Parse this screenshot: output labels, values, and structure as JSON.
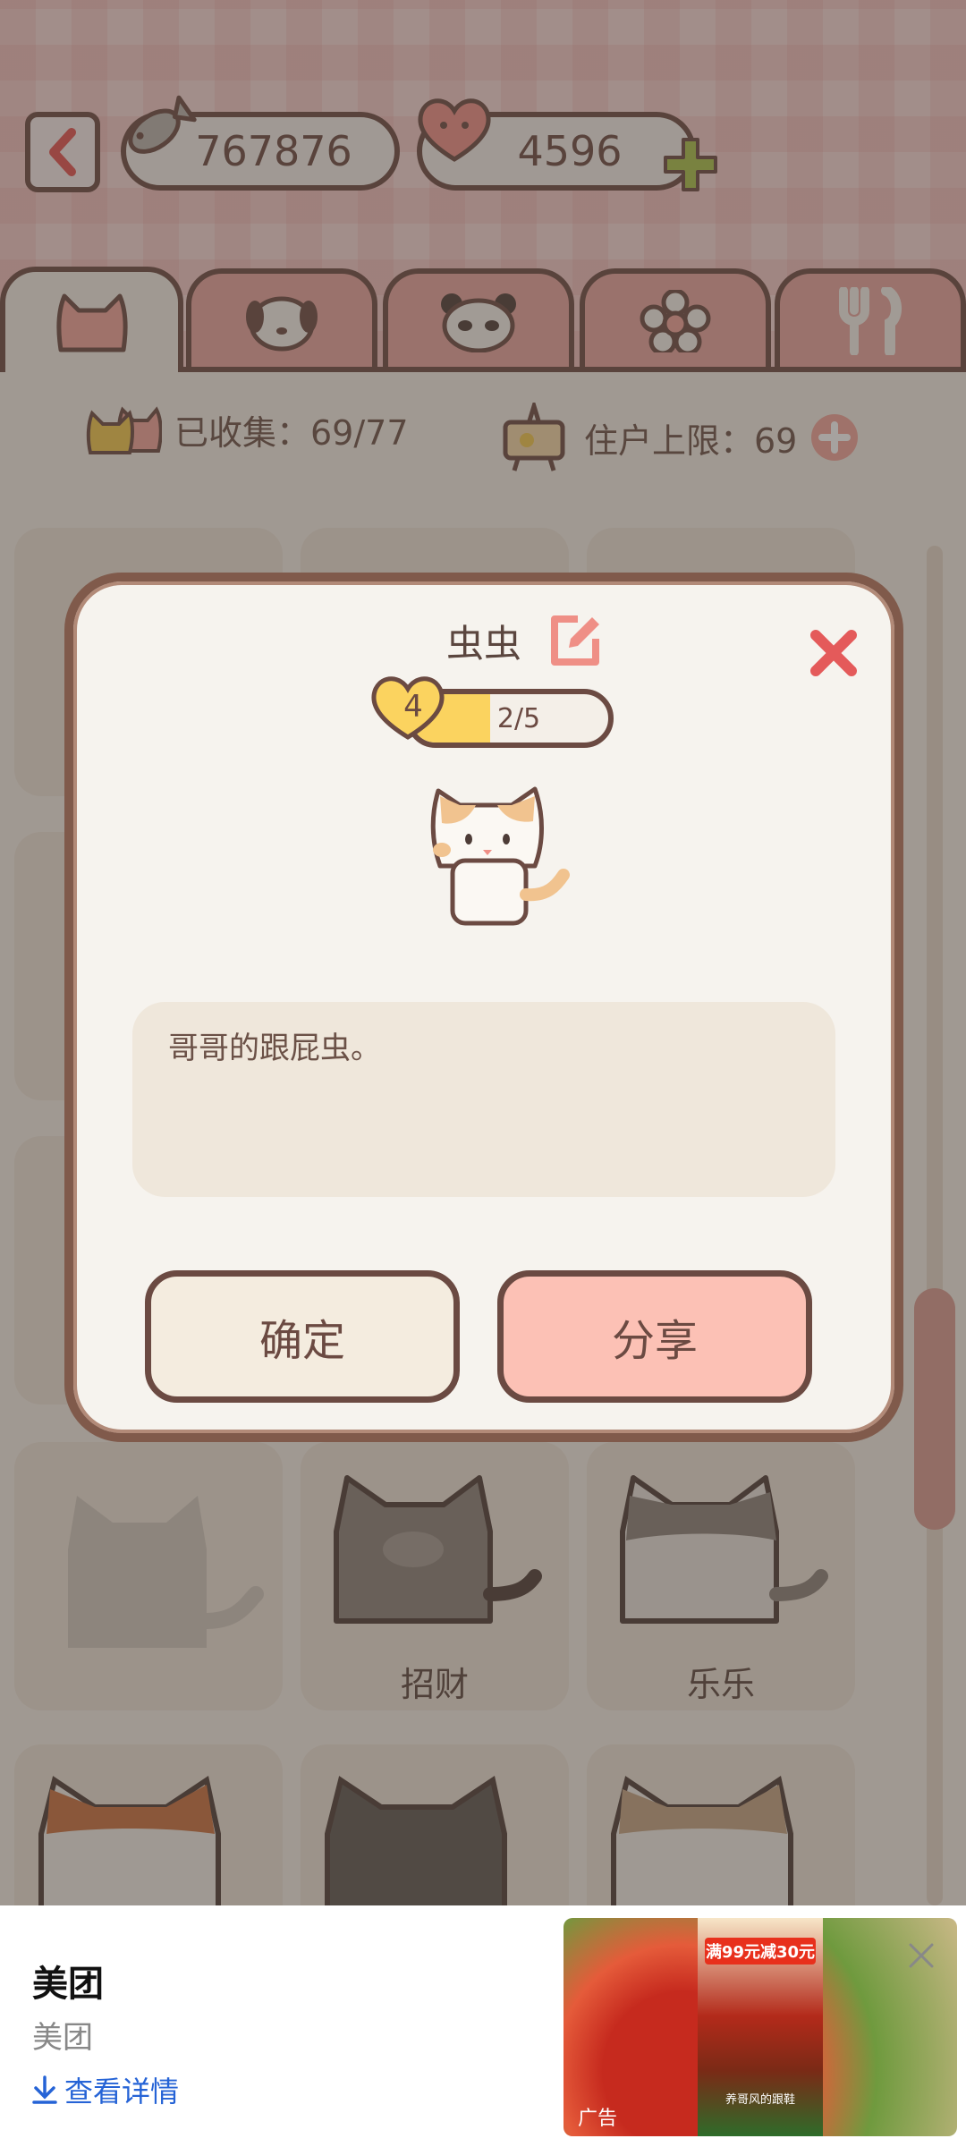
{
  "header": {
    "fish_count": "767876",
    "heart_count": "4596"
  },
  "tabs": [
    {
      "icon": "cat-tab-icon",
      "active": true
    },
    {
      "icon": "dog-tab-icon",
      "active": false
    },
    {
      "icon": "panda-tab-icon",
      "active": false
    },
    {
      "icon": "flower-tab-icon",
      "active": false
    },
    {
      "icon": "fork-tab-icon",
      "active": false
    }
  ],
  "stats": {
    "collected_label": "已收集：69/77",
    "capacity_label": "住户上限：69"
  },
  "grid": {
    "names": [
      "招财",
      "乐乐"
    ]
  },
  "modal": {
    "title": "虫虫",
    "level": "4",
    "progress_text": "2/5",
    "progress_fraction": 0.4,
    "description": "哥哥的跟屁虫。",
    "confirm_label": "确定",
    "share_label": "分享"
  },
  "ad": {
    "title": "美团",
    "subtitle": "美团",
    "link_label": "查看详情",
    "promo_text": "满99元减30元",
    "poster_caption": "养哥风的跟鞋",
    "tag": "广告"
  },
  "colors": {
    "accent_pink": "#e9a39d",
    "close_red": "#e45a5a",
    "progress_yellow": "#fbd35f",
    "share_pink": "#fcc1b5",
    "link_blue": "#2563d6"
  }
}
